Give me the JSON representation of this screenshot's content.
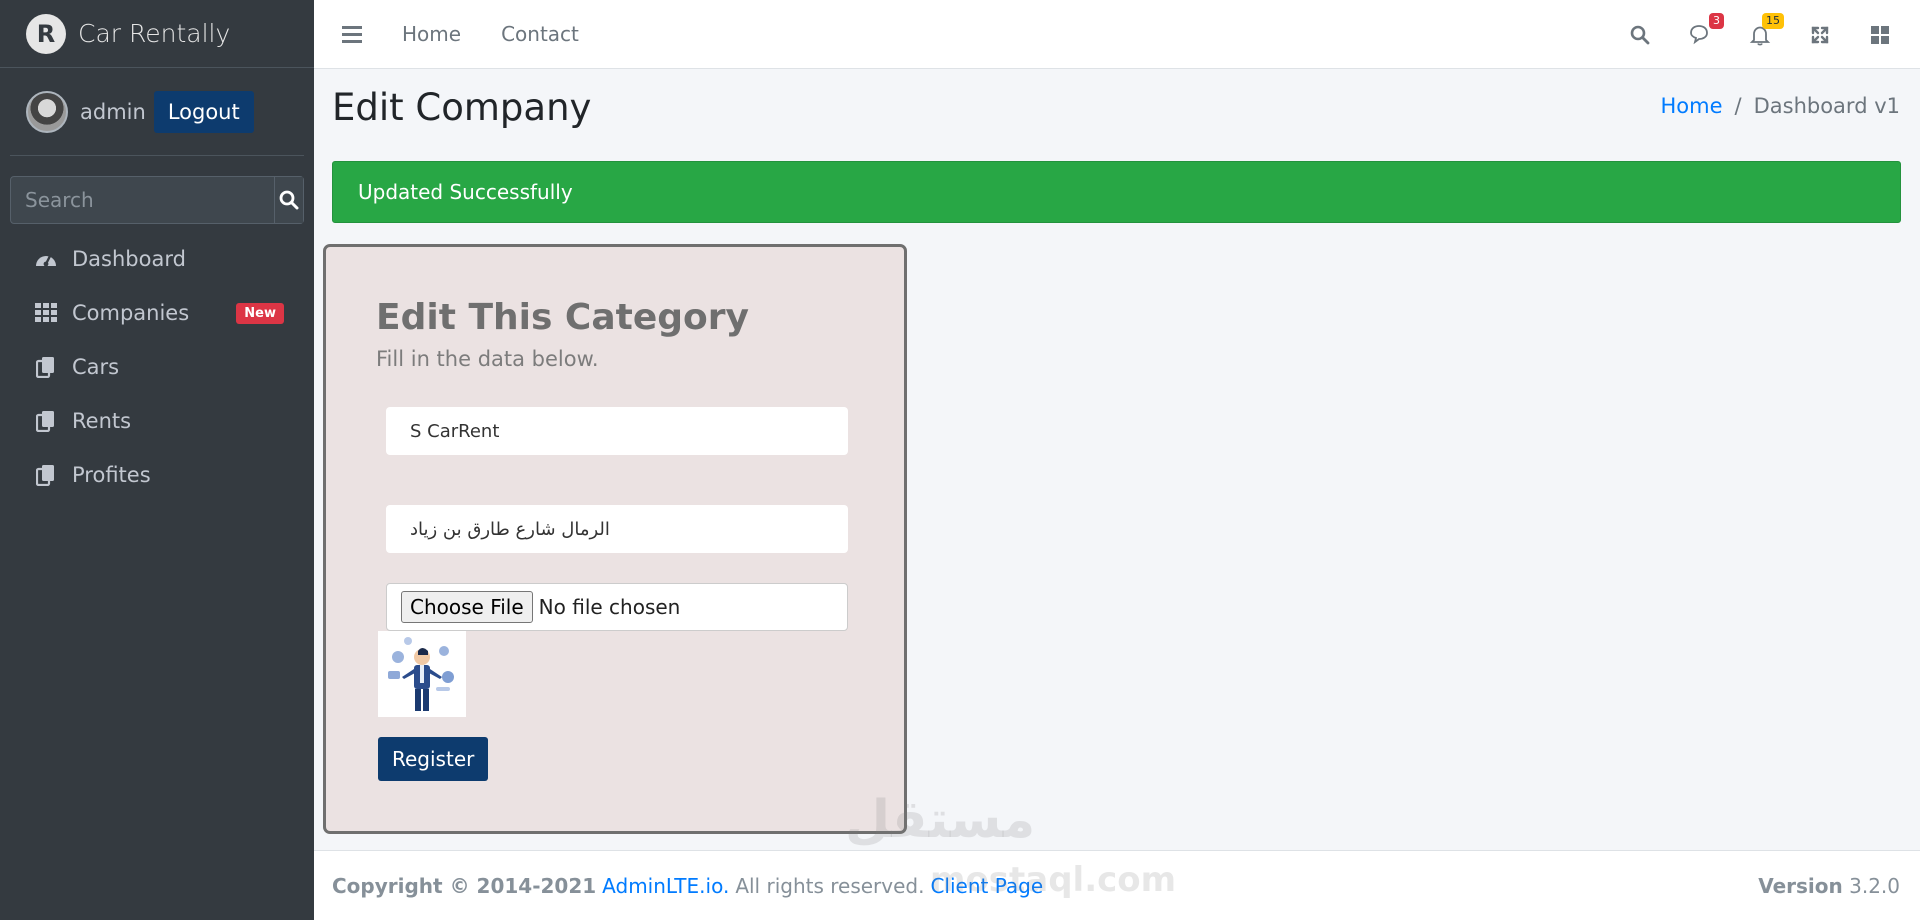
{
  "brand": {
    "name": "Car Rentally",
    "logo_letter": "R"
  },
  "user": {
    "name": "admin",
    "logout_label": "Logout"
  },
  "sidebar": {
    "search_placeholder": "Search",
    "items": [
      {
        "label": "Dashboard",
        "icon": "tachometer-icon"
      },
      {
        "label": "Companies",
        "icon": "grid-icon",
        "badge": "New"
      },
      {
        "label": "Cars",
        "icon": "copy-icon"
      },
      {
        "label": "Rents",
        "icon": "copy-icon"
      },
      {
        "label": "Profites",
        "icon": "copy-icon"
      }
    ]
  },
  "topbar": {
    "links": [
      "Home",
      "Contact"
    ],
    "messages_count": "3",
    "notifications_count": "15"
  },
  "page": {
    "title": "Edit Company",
    "breadcrumb": {
      "home": "Home",
      "separator": "/",
      "current": "Dashboard v1"
    }
  },
  "alert": {
    "text": "Updated Successfully"
  },
  "form": {
    "title": "Edit This Category",
    "subtitle": "Fill in the data below.",
    "name_value": "S CarRent",
    "address_value": "الرمال شارع طارق بن زياد",
    "choose_file_label": "Choose File",
    "no_file_text": "No file chosen",
    "submit_label": "Register"
  },
  "footer": {
    "copyright": "Copyright © 2014-2021",
    "adminlte_link": "AdminLTE.io.",
    "rights": "All rights reserved.",
    "client_link": "Client Page",
    "version_label": "Version",
    "version_value": "3.2.0"
  },
  "watermark": {
    "line1": "مستقل",
    "line2": "mostaql.com"
  },
  "colors": {
    "sidebar_bg": "#343a40",
    "primary_btn": "#0d3b6e",
    "success": "#28a745",
    "link": "#007bff",
    "danger": "#dc3545",
    "warning": "#ffc107",
    "card_bg": "#ebe2e2"
  }
}
